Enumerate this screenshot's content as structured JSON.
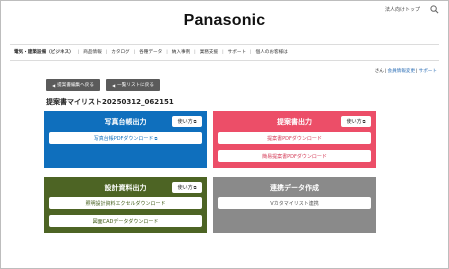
{
  "header": {
    "corporate_link": "法人向けトップ",
    "search_icon": "search-icon",
    "logo_text": "Panasonic"
  },
  "nav": {
    "items": [
      "電気・建築設備（ビジネス）",
      "商品情報",
      "カタログ",
      "各種データ",
      "納入事例",
      "業務支援",
      "サポート",
      "個人のお客様は"
    ]
  },
  "user": {
    "name_suffix": "さん",
    "link_member": "会員情報変更",
    "link_support": "サポート"
  },
  "actions": {
    "back_to_edit": "提案書編集へ戻る",
    "back_to_list": "一覧リストに戻る"
  },
  "list_title": "提案書マイリスト20250312_062151",
  "panels": {
    "photo": {
      "title": "写真台帳出力",
      "usage": "使い方",
      "buttons": [
        "写真台帳PDFダウンロード"
      ]
    },
    "proposal": {
      "title": "提案書出力",
      "usage": "使い方",
      "buttons": [
        "提案書PDFダウンロード",
        "簡易提案書PDFダウンロード"
      ]
    },
    "design": {
      "title": "設計資料出力",
      "usage": "使い方",
      "buttons": [
        "照明設計資料エクセルダウンロード",
        "図面CADデータダウンロード"
      ]
    },
    "integration": {
      "title": "連携データ作成",
      "buttons": [
        "Vカタマイリスト連携"
      ]
    }
  },
  "colors": {
    "blue": "#0f6fbd",
    "red": "#ec4e68",
    "green": "#4d6424",
    "gray": "#8a8a8a"
  }
}
